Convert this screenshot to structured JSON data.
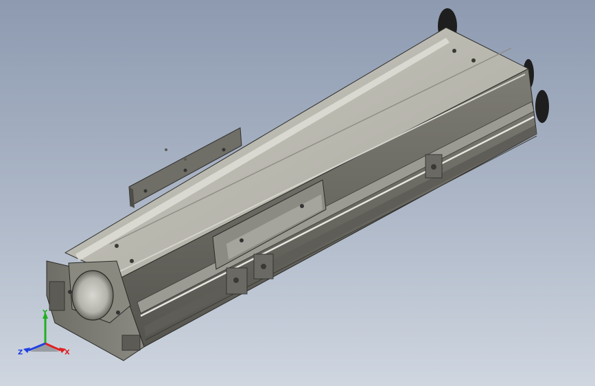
{
  "view": {
    "background_top": "#8d9ab0",
    "background_bottom": "#cfd6e0",
    "model_name": "linear-actuator-module"
  },
  "triad": {
    "x_label": "X",
    "y_label": "Y",
    "z_label": "Z",
    "x_color": "#e02020",
    "y_color": "#20b020",
    "z_color": "#2040e0"
  }
}
